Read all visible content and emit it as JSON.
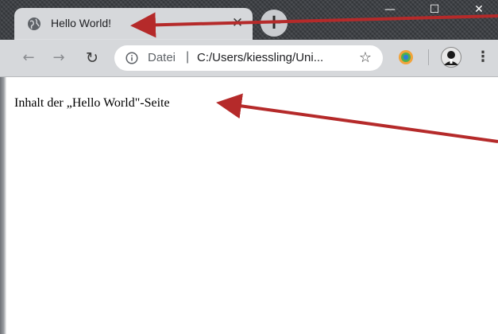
{
  "window": {
    "minimize_glyph": "—",
    "maximize_glyph": "☐",
    "close_glyph": "✕"
  },
  "tab": {
    "title": "Hello World!",
    "icon": "globe-icon",
    "close_glyph": "✕"
  },
  "new_tab": {
    "glyph": "+"
  },
  "toolbar": {
    "back_glyph": "←",
    "forward_glyph": "→",
    "reload_glyph": "↻",
    "url_scheme_label": "Datei",
    "url_separator": "|",
    "url": "C:/Users/kiessling/Uni...",
    "bookmark_glyph": "☆",
    "menu_glyph": "⋮"
  },
  "page": {
    "text": "Inhalt der „Hello World\"-Seite"
  },
  "colors": {
    "annotation_arrow": "#b52a2a",
    "titlebar": "#3a3d42",
    "toolbar": "#d6d8db"
  }
}
